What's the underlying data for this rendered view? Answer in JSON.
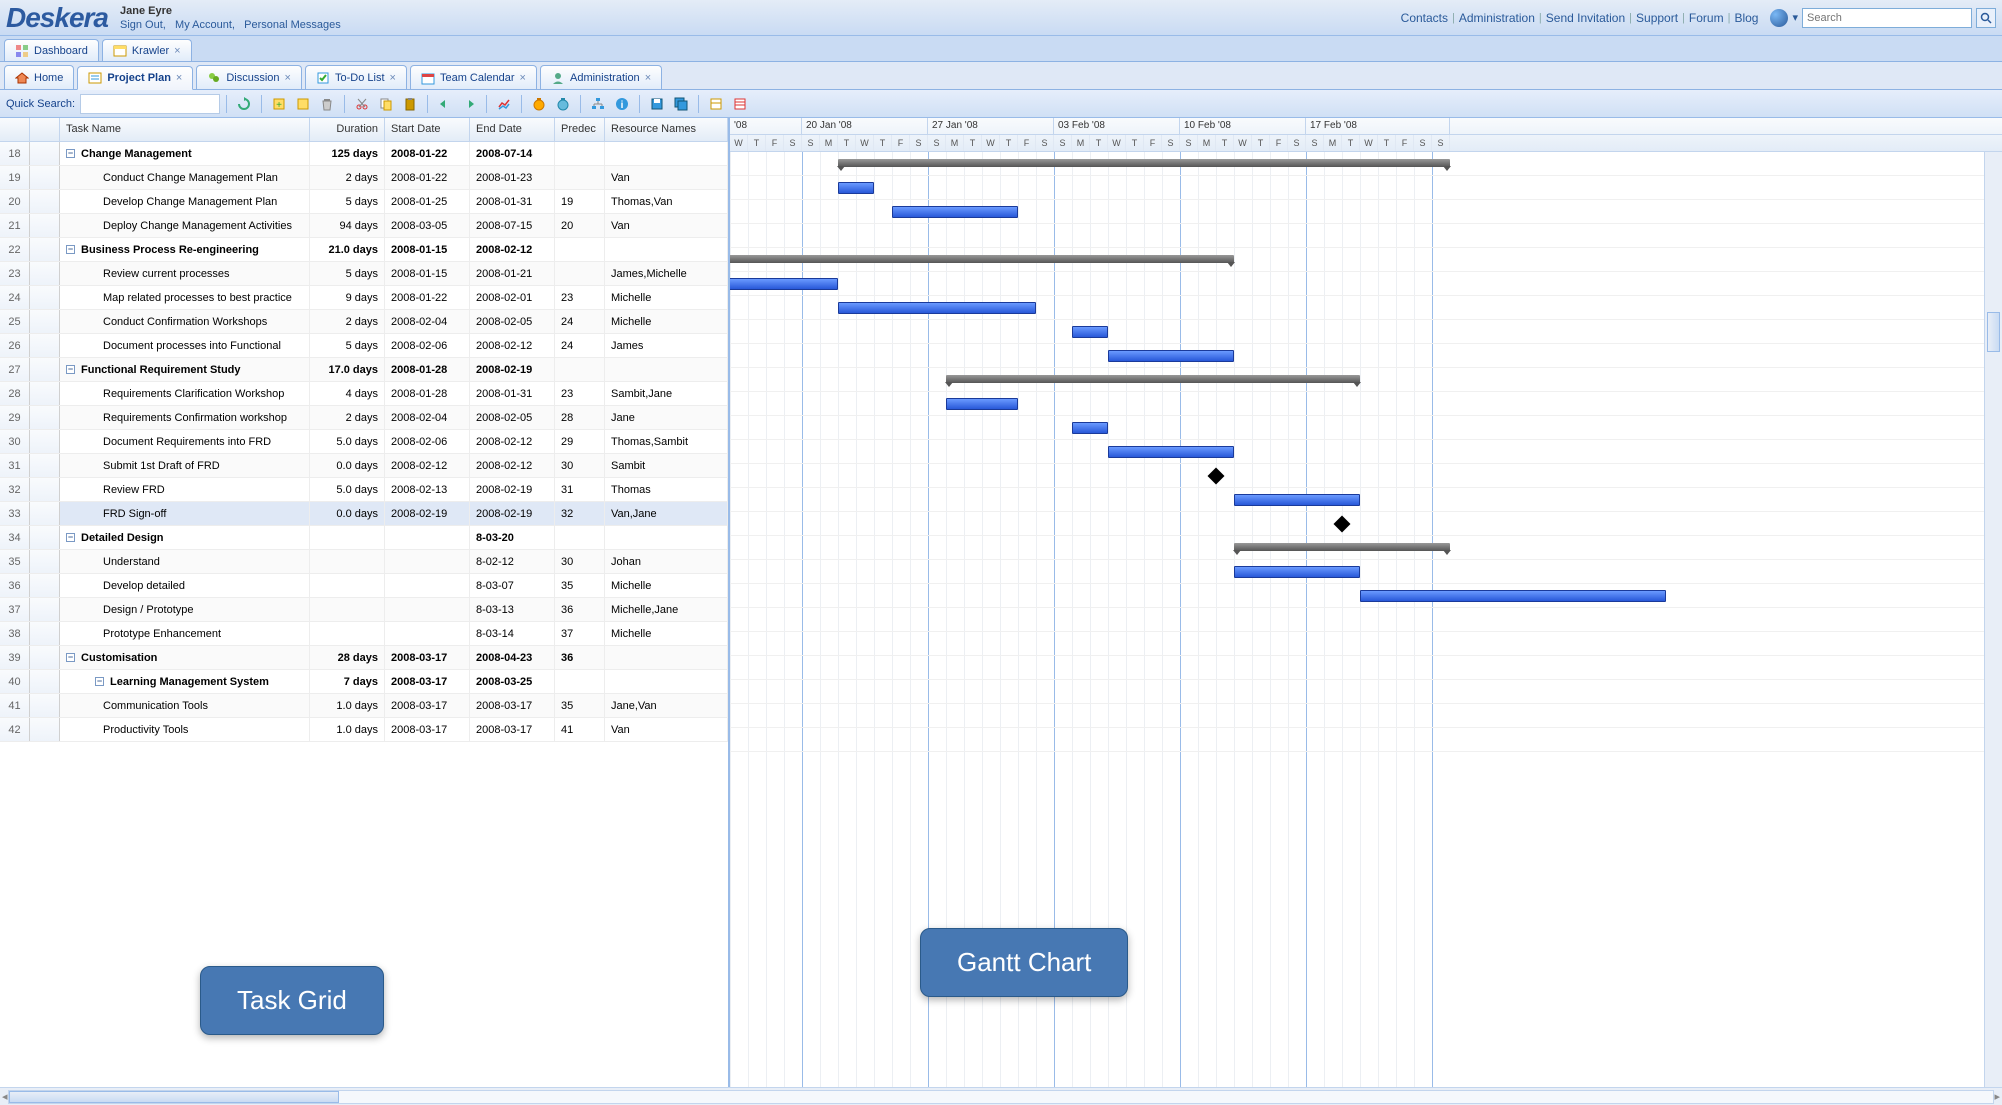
{
  "app": {
    "name": "Deskera"
  },
  "user": {
    "name": "Jane Eyre",
    "links": {
      "signout": "Sign Out",
      "account": "My Account",
      "messages": "Personal Messages"
    }
  },
  "topnav": {
    "contacts": "Contacts",
    "admin": "Administration",
    "invite": "Send Invitation",
    "support": "Support",
    "forum": "Forum",
    "blog": "Blog",
    "search_placeholder": "Search"
  },
  "main_tabs": [
    {
      "label": "Dashboard",
      "closable": false
    },
    {
      "label": "Krawler",
      "closable": true
    }
  ],
  "sub_tabs": [
    {
      "label": "Home",
      "closable": false,
      "active": false
    },
    {
      "label": "Project Plan",
      "closable": true,
      "active": true
    },
    {
      "label": "Discussion",
      "closable": true,
      "active": false
    },
    {
      "label": "To-Do List",
      "closable": true,
      "active": false
    },
    {
      "label": "Team Calendar",
      "closable": true,
      "active": false
    },
    {
      "label": "Administration",
      "closable": true,
      "active": false
    }
  ],
  "toolbar": {
    "quick_search": "Quick Search:"
  },
  "grid": {
    "headers": {
      "name": "Task Name",
      "dur": "Duration",
      "start": "Start Date",
      "end": "End Date",
      "pred": "Predec",
      "res": "Resource Names"
    },
    "rows": [
      {
        "n": 18,
        "lvl": 0,
        "sum": true,
        "name": "Change Management",
        "dur": "125 days",
        "start": "2008-01-22",
        "end": "2008-07-14"
      },
      {
        "n": 19,
        "lvl": 2,
        "name": "Conduct Change Management Plan",
        "dur": "2 days",
        "start": "2008-01-22",
        "end": "2008-01-23",
        "res": "Van"
      },
      {
        "n": 20,
        "lvl": 2,
        "name": "Develop Change Management Plan",
        "dur": "5 days",
        "start": "2008-01-25",
        "end": "2008-01-31",
        "pred": "19",
        "res": "Thomas,Van"
      },
      {
        "n": 21,
        "lvl": 2,
        "name": "Deploy Change Management Activities",
        "dur": "94 days",
        "start": "2008-03-05",
        "end": "2008-07-15",
        "pred": "20",
        "res": "Van"
      },
      {
        "n": 22,
        "lvl": 0,
        "sum": true,
        "name": "Business Process Re-engineering",
        "dur": "21.0 days",
        "start": "2008-01-15",
        "end": "2008-02-12"
      },
      {
        "n": 23,
        "lvl": 2,
        "name": "Review current processes",
        "dur": "5 days",
        "start": "2008-01-15",
        "end": "2008-01-21",
        "res": "James,Michelle"
      },
      {
        "n": 24,
        "lvl": 2,
        "name": "Map related processes to best practice",
        "dur": "9 days",
        "start": "2008-01-22",
        "end": "2008-02-01",
        "pred": "23",
        "res": "Michelle"
      },
      {
        "n": 25,
        "lvl": 2,
        "name": "Conduct Confirmation Workshops",
        "dur": "2 days",
        "start": "2008-02-04",
        "end": "2008-02-05",
        "pred": "24",
        "res": "Michelle"
      },
      {
        "n": 26,
        "lvl": 2,
        "name": "Document processes into Functional",
        "dur": "5 days",
        "start": "2008-02-06",
        "end": "2008-02-12",
        "pred": "24",
        "res": "James"
      },
      {
        "n": 27,
        "lvl": 0,
        "sum": true,
        "name": "Functional Requirement Study",
        "dur": "17.0 days",
        "start": "2008-01-28",
        "end": "2008-02-19"
      },
      {
        "n": 28,
        "lvl": 2,
        "name": "Requirements Clarification Workshop",
        "dur": "4 days",
        "start": "2008-01-28",
        "end": "2008-01-31",
        "pred": "23",
        "res": "Sambit,Jane"
      },
      {
        "n": 29,
        "lvl": 2,
        "name": "Requirements Confirmation workshop",
        "dur": "2 days",
        "start": "2008-02-04",
        "end": "2008-02-05",
        "pred": "28",
        "res": "Jane"
      },
      {
        "n": 30,
        "lvl": 2,
        "name": "Document Requirements into FRD",
        "dur": "5.0 days",
        "start": "2008-02-06",
        "end": "2008-02-12",
        "pred": "29",
        "res": "Thomas,Sambit"
      },
      {
        "n": 31,
        "lvl": 2,
        "name": "Submit 1st Draft of FRD",
        "dur": "0.0 days",
        "start": "2008-02-12",
        "end": "2008-02-12",
        "pred": "30",
        "res": "Sambit"
      },
      {
        "n": 32,
        "lvl": 2,
        "name": "Review FRD",
        "dur": "5.0 days",
        "start": "2008-02-13",
        "end": "2008-02-19",
        "pred": "31",
        "res": "Thomas"
      },
      {
        "n": 33,
        "lvl": 2,
        "sel": true,
        "name": "FRD Sign-off",
        "dur": "0.0 days",
        "start": "2008-02-19",
        "end": "2008-02-19",
        "pred": "32",
        "res": "Van,Jane"
      },
      {
        "n": 34,
        "lvl": 0,
        "sum": true,
        "name": "Detailed Design",
        "dur": "",
        "start": "",
        "end": "8-03-20"
      },
      {
        "n": 35,
        "lvl": 2,
        "name": "Understand",
        "dur": "",
        "start": "",
        "end": "8-02-12",
        "pred": "30",
        "res": "Johan"
      },
      {
        "n": 36,
        "lvl": 2,
        "name": "Develop detailed",
        "dur": "",
        "start": "",
        "end": "8-03-07",
        "pred": "35",
        "res": "Michelle"
      },
      {
        "n": 37,
        "lvl": 2,
        "name": "Design / Prototype",
        "dur": "",
        "start": "",
        "end": "8-03-13",
        "pred": "36",
        "res": "Michelle,Jane"
      },
      {
        "n": 38,
        "lvl": 2,
        "name": "Prototype Enhancement",
        "dur": "",
        "start": "",
        "end": "8-03-14",
        "pred": "37",
        "res": "Michelle"
      },
      {
        "n": 39,
        "lvl": 0,
        "sum": true,
        "name": "Customisation",
        "dur": "28 days",
        "start": "2008-03-17",
        "end": "2008-04-23",
        "pred": "36"
      },
      {
        "n": 40,
        "lvl": 1,
        "sum": true,
        "name": "Learning Management System",
        "dur": "7 days",
        "start": "2008-03-17",
        "end": "2008-03-25"
      },
      {
        "n": 41,
        "lvl": 2,
        "name": "Communication Tools",
        "dur": "1.0 days",
        "start": "2008-03-17",
        "end": "2008-03-17",
        "pred": "35",
        "res": "Jane,Van"
      },
      {
        "n": 42,
        "lvl": 2,
        "name": "Productivity Tools",
        "dur": "1.0 days",
        "start": "2008-03-17",
        "end": "2008-03-17",
        "pred": "41",
        "res": "Van"
      }
    ]
  },
  "gantt": {
    "weeks": [
      "'08",
      "20 Jan '08",
      "27 Jan '08",
      "03 Feb '08",
      "10 Feb '08",
      "17 Feb '08"
    ],
    "days": "WTFSSMTWTFSSMTWTFSSMTWTFSSMTWTFSSMTWTFSS"
  },
  "callouts": {
    "left": "Task Grid",
    "right": "Gantt Chart"
  },
  "chart_data": {
    "type": "gantt",
    "timeline_start": "2008-01-16",
    "timeline_end": "2008-02-24",
    "bars": [
      {
        "row": 18,
        "type": "summary",
        "start": "2008-01-22",
        "end": "2008-07-14"
      },
      {
        "row": 19,
        "type": "task",
        "start": "2008-01-22",
        "end": "2008-01-23"
      },
      {
        "row": 20,
        "type": "task",
        "start": "2008-01-25",
        "end": "2008-01-31"
      },
      {
        "row": 22,
        "type": "summary",
        "start": "2008-01-15",
        "end": "2008-02-12"
      },
      {
        "row": 23,
        "type": "task",
        "start": "2008-01-15",
        "end": "2008-01-21"
      },
      {
        "row": 24,
        "type": "task",
        "start": "2008-01-22",
        "end": "2008-02-01"
      },
      {
        "row": 25,
        "type": "task",
        "start": "2008-02-04",
        "end": "2008-02-05"
      },
      {
        "row": 26,
        "type": "task",
        "start": "2008-02-06",
        "end": "2008-02-12"
      },
      {
        "row": 27,
        "type": "summary",
        "start": "2008-01-28",
        "end": "2008-02-19"
      },
      {
        "row": 28,
        "type": "task",
        "start": "2008-01-28",
        "end": "2008-01-31"
      },
      {
        "row": 29,
        "type": "task",
        "start": "2008-02-04",
        "end": "2008-02-05"
      },
      {
        "row": 30,
        "type": "task",
        "start": "2008-02-06",
        "end": "2008-02-12"
      },
      {
        "row": 31,
        "type": "milestone",
        "start": "2008-02-12"
      },
      {
        "row": 32,
        "type": "task",
        "start": "2008-02-13",
        "end": "2008-02-19"
      },
      {
        "row": 33,
        "type": "milestone",
        "start": "2008-02-19"
      },
      {
        "row": 34,
        "type": "summary",
        "start": "2008-02-13",
        "end": "2008-03-20"
      },
      {
        "row": 35,
        "type": "task",
        "start": "2008-02-13",
        "end": "2008-02-19"
      },
      {
        "row": 36,
        "type": "task",
        "start": "2008-02-20",
        "end": "2008-03-07"
      }
    ],
    "dependencies": [
      [
        19,
        20
      ],
      [
        23,
        24
      ],
      [
        24,
        25
      ],
      [
        24,
        26
      ],
      [
        23,
        28
      ],
      [
        28,
        29
      ],
      [
        29,
        30
      ],
      [
        30,
        31
      ],
      [
        31,
        32
      ],
      [
        32,
        33
      ],
      [
        30,
        35
      ],
      [
        35,
        36
      ]
    ]
  }
}
